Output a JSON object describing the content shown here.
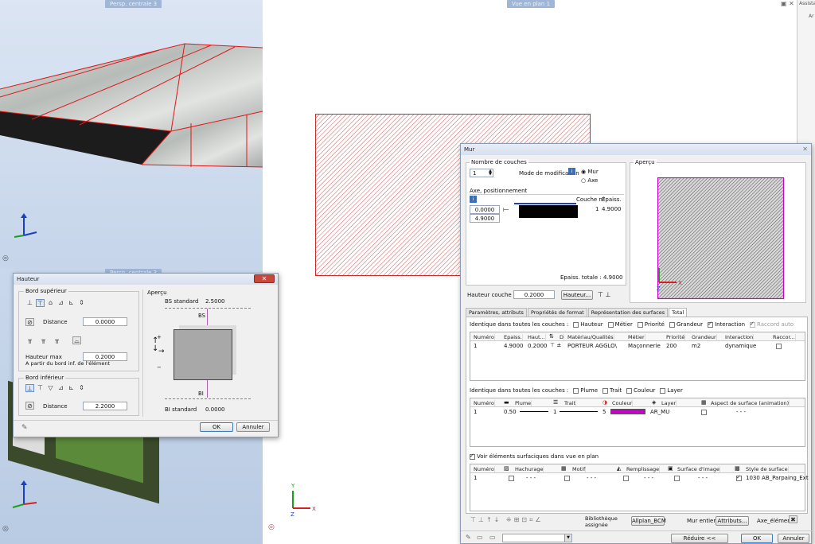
{
  "viewports": {
    "left_top_title": "Persp. centrale 3",
    "left_bottom_title": "Persp. centrale 3",
    "mid_title": "Vue en plan 1",
    "right_title": "Assista",
    "right_sub": "Ar"
  },
  "hauteur": {
    "title": "Hauteur",
    "close": "✕",
    "top_group": "Bord supérieur",
    "distance_label": "Distance",
    "distance_top": "0.0000",
    "max_label": "Hauteur max",
    "max_value": "0.2000",
    "from_label": "A partir du bord inf. de l'élément",
    "bottom_group": "Bord inférieur",
    "distance_bottom": "2.2000",
    "apercu": "Aperçu",
    "bs_std": "BS standard",
    "bs_val": "2.5000",
    "bs": "BS",
    "bi": "BI",
    "bi_std": "BI standard",
    "bi_val": "0.0000",
    "ok": "OK",
    "annuler": "Annuler"
  },
  "mur": {
    "title": "Mur",
    "close": "✕",
    "nb_couches": "Nombre de couches",
    "nb_value": "1",
    "mode_label": "Mode de modification",
    "radio_mur": "Mur",
    "radio_axe": "Axe",
    "axe_group": "Axe, positionnement",
    "couche_n": "Couche n°",
    "epais": "Epaiss.",
    "couche_row_n": "1",
    "couche_row_val": "4.9000",
    "pos1": "0.0000",
    "pos2": "4.9000",
    "epais_totale_label": "Epaiss. totale :",
    "epais_totale": "4.9000",
    "apercu": "Aperçu",
    "hauteur_couche_label": "Hauteur couche 1 :",
    "hauteur_couche": "0.2000",
    "hauteur_btn": "Hauteur...",
    "tabs": [
      "Paramètres, attributs",
      "Propriétés de format",
      "Représentation des surfaces",
      "Total"
    ],
    "ident1_label": "Identique dans toutes les couches :",
    "ident1_checks": [
      "Hauteur",
      "Métier",
      "Priorité",
      "Grandeur",
      "Interaction",
      "Raccord auto"
    ],
    "t1_headers": [
      "Numéro",
      "Epaiss.",
      "Haut...",
      "",
      "D",
      "Matériau/Qualités",
      "Métier",
      "Priorité",
      "Grandeur",
      "Interaction",
      "Raccor..."
    ],
    "t1_row": [
      "1",
      "4.9000",
      "0.2000",
      "",
      "",
      "PORTEUR AGGLO\\",
      "Maçonnerie",
      "200",
      "m2",
      "dynamique",
      ""
    ],
    "ident2_label": "Identique dans toutes les couches :",
    "ident2_checks": [
      "Plume",
      "Trait",
      "Couleur",
      "Layer"
    ],
    "t2_headers": [
      "Numéro",
      "Plume",
      "Trait",
      "Couleur",
      "Layer",
      "Aspect de surface (animation)"
    ],
    "t2_row": [
      "1",
      "0.50",
      "1",
      "5",
      "AR_MU",
      "- - -"
    ],
    "voir_label": "Voir éléments surfaciques dans vue en plan",
    "t3_headers": [
      "Numéro",
      "Hachurage",
      "Motif",
      "Remplissage",
      "Surface d'image",
      "Style de surface"
    ],
    "t3_row": [
      "1",
      "- - -",
      "- - -",
      "- - -",
      "- - -",
      "1030 AB_Parpaing_Ext"
    ],
    "biblio": "Bibliothèque\nassignée",
    "allplan_btn": "Allplan_BCM",
    "mur_entier": "Mur entier",
    "attributs_btn": "Attributs...",
    "axe_element": "Axe_élément",
    "reduire": "Réduire <<",
    "ok": "OK",
    "annuler": "Annuler"
  },
  "colors": {
    "accent": "#cc00cc",
    "hatch": "#cc2a2a",
    "blue": "#1b3fc4",
    "green": "#19a019",
    "red": "#d32020"
  }
}
